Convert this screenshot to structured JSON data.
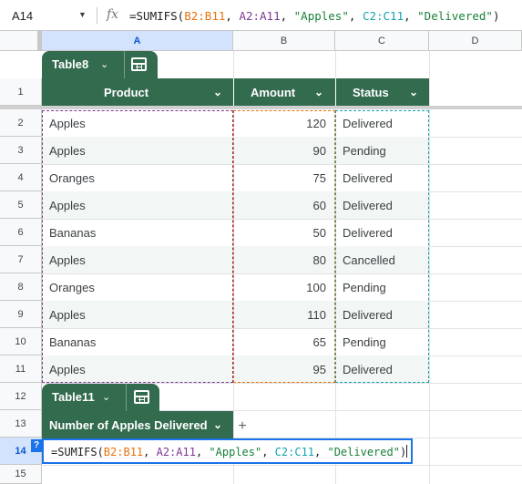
{
  "formula_bar": {
    "cell_ref": "A14",
    "fx_label": "fx",
    "formula_parts": [
      {
        "text": "=SUMIFS(",
        "cls": "c-fn"
      },
      {
        "text": "B2:B11",
        "cls": "c-b"
      },
      {
        "text": ", ",
        "cls": "c-fn"
      },
      {
        "text": "A2:A11",
        "cls": "c-a"
      },
      {
        "text": ", ",
        "cls": "c-fn"
      },
      {
        "text": "\"Apples\"",
        "cls": "c-s"
      },
      {
        "text": ", ",
        "cls": "c-fn"
      },
      {
        "text": "C2:C11",
        "cls": "c-c"
      },
      {
        "text": ", ",
        "cls": "c-fn"
      },
      {
        "text": "\"Delivered\"",
        "cls": "c-s"
      },
      {
        "text": ")",
        "cls": "c-fn"
      }
    ]
  },
  "columns": [
    "A",
    "B",
    "C",
    "D"
  ],
  "selected_column": "A",
  "rows": [
    "1",
    "2",
    "3",
    "4",
    "5",
    "6",
    "7",
    "8",
    "9",
    "10",
    "11",
    "12",
    "13",
    "14",
    "15"
  ],
  "selected_row": "14",
  "table1": {
    "name": "Table8",
    "headers": {
      "product": "Product",
      "amount": "Amount",
      "status": "Status"
    },
    "data": [
      {
        "product": "Apples",
        "amount": "120",
        "status": "Delivered"
      },
      {
        "product": "Apples",
        "amount": "90",
        "status": "Pending"
      },
      {
        "product": "Oranges",
        "amount": "75",
        "status": "Delivered"
      },
      {
        "product": "Apples",
        "amount": "60",
        "status": "Delivered"
      },
      {
        "product": "Bananas",
        "amount": "50",
        "status": "Delivered"
      },
      {
        "product": "Apples",
        "amount": "80",
        "status": "Cancelled"
      },
      {
        "product": "Oranges",
        "amount": "100",
        "status": "Pending"
      },
      {
        "product": "Apples",
        "amount": "110",
        "status": "Delivered"
      },
      {
        "product": "Bananas",
        "amount": "65",
        "status": "Pending"
      },
      {
        "product": "Apples",
        "amount": "95",
        "status": "Delivered"
      }
    ]
  },
  "table2": {
    "name": "Table11",
    "header": "Number of Apples Delivered"
  },
  "editor": {
    "help": "?"
  },
  "colors": {
    "table_green": "#336b4f",
    "range_b": "#e8710a",
    "range_a": "#7e3794",
    "range_c": "#12a4af",
    "selection_blue": "#1a73e8"
  }
}
